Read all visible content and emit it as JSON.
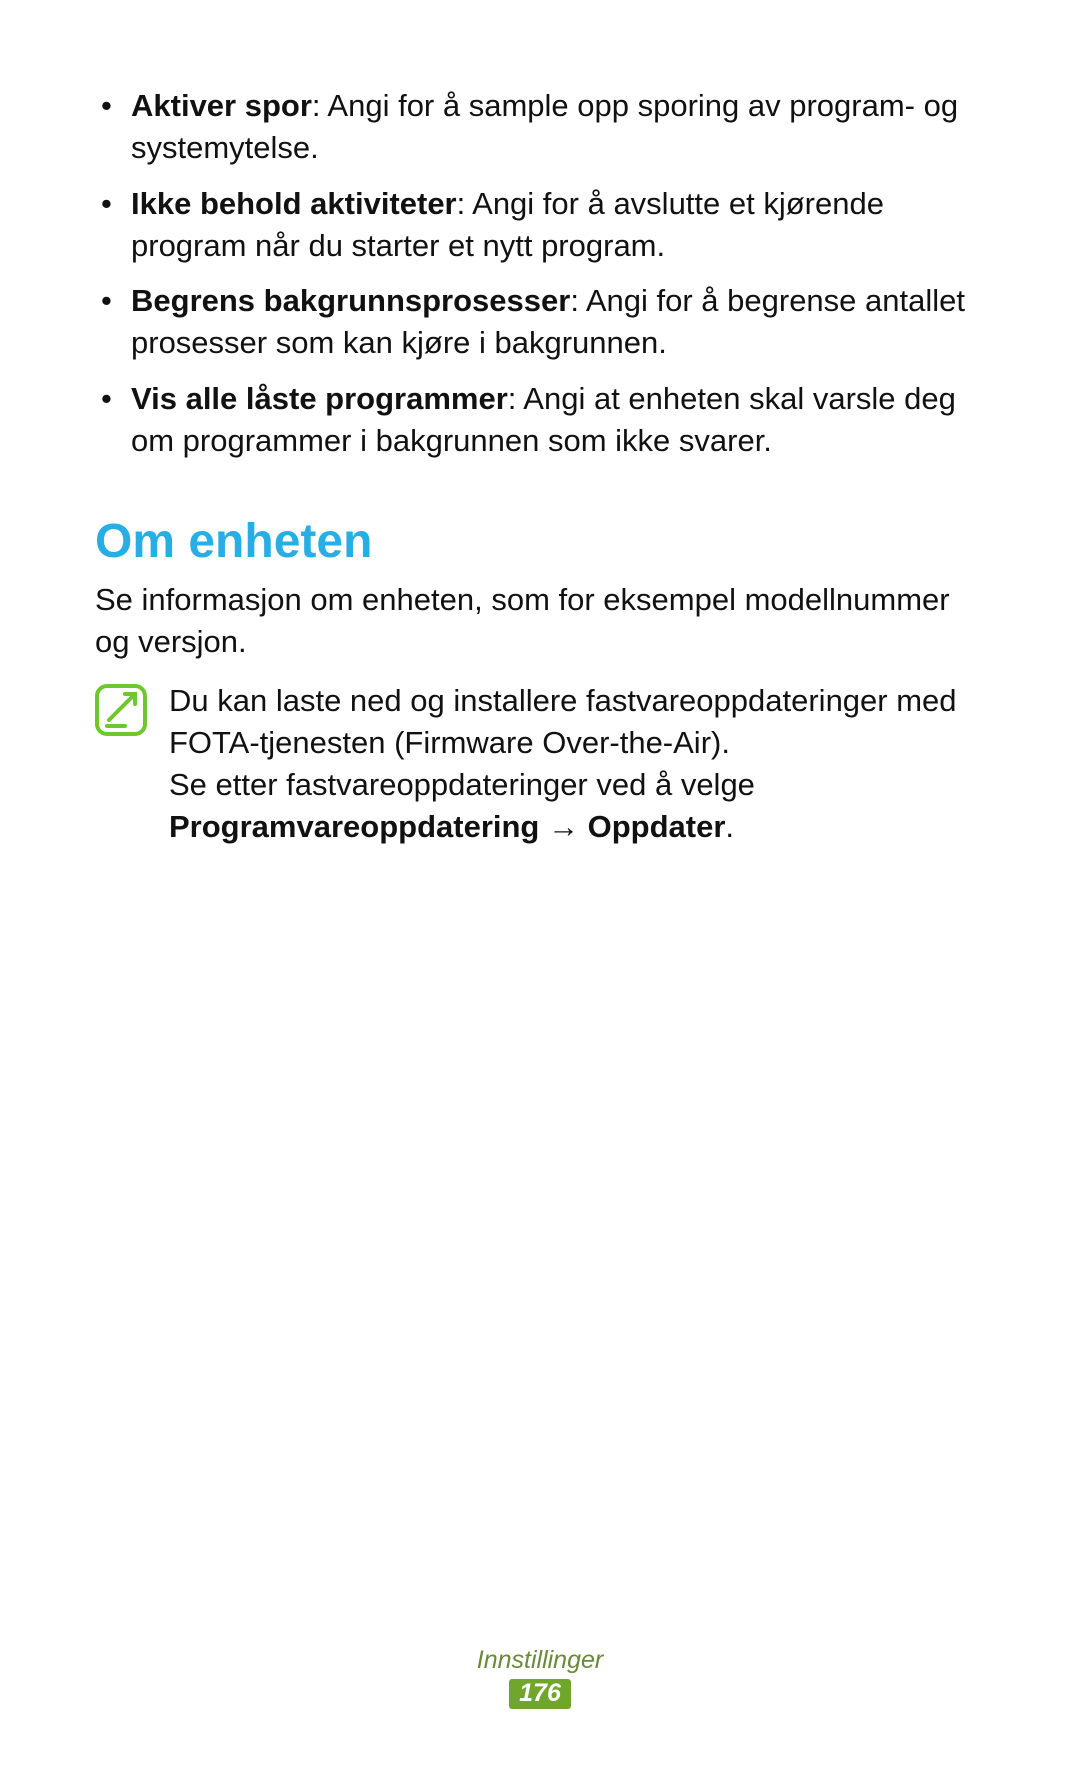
{
  "bullets": [
    {
      "label": "Aktiver spor",
      "text": ": Angi for å sample opp sporing av program- og systemytelse."
    },
    {
      "label": "Ikke behold aktiviteter",
      "text": ": Angi for å avslutte et kjørende program når du starter et nytt program."
    },
    {
      "label": "Begrens bakgrunnsprosesser",
      "text": ": Angi for å begrense antallet prosesser som kan kjøre i bakgrunnen."
    },
    {
      "label": "Vis alle låste programmer",
      "text": ": Angi at enheten skal varsle deg om programmer i bakgrunnen som ikke svarer."
    }
  ],
  "section": {
    "heading": "Om enheten",
    "intro": "Se informasjon om enheten, som for eksempel modellnummer og versjon."
  },
  "note": {
    "line1": "Du kan laste ned og installere fastvareoppdateringer med FOTA-tjenesten (Firmware Over-the-Air).",
    "line2": "Se etter fastvareoppdateringer ved å velge",
    "bold_part": "Programvareoppdatering → Oppdater",
    "bold_trail": "."
  },
  "footer": {
    "section_name": "Innstillinger",
    "page_number": "176"
  }
}
